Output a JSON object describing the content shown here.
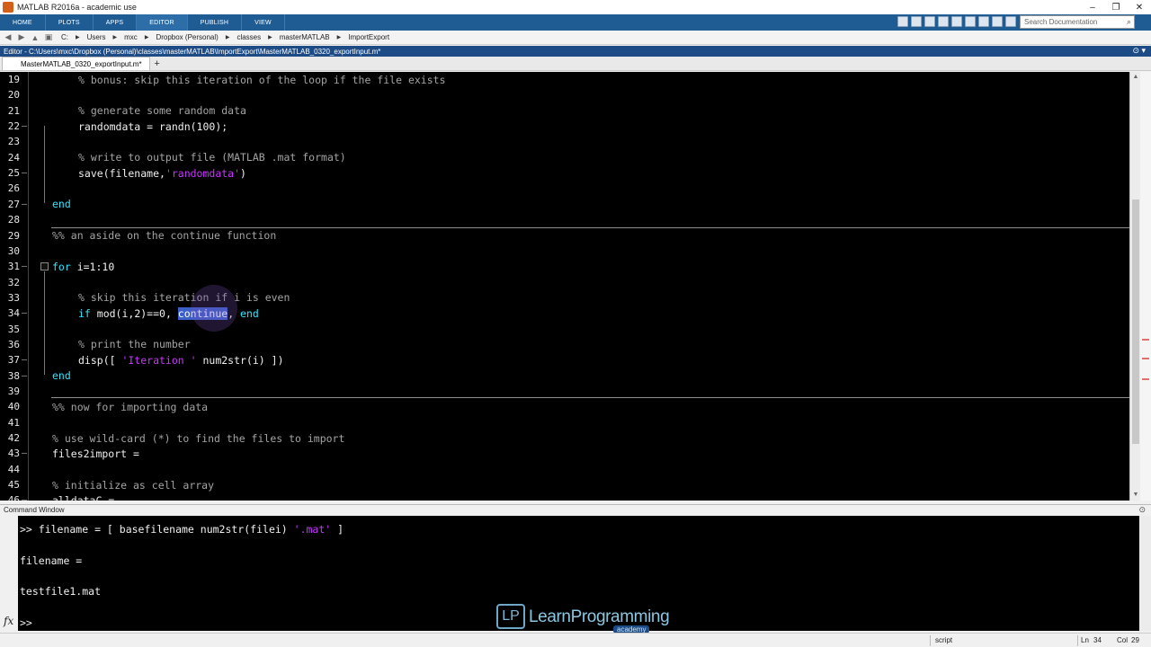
{
  "window": {
    "title": "MATLAB R2016a - academic use",
    "controls": [
      "–",
      "❐",
      "✕"
    ]
  },
  "ribbon": {
    "tabs": [
      {
        "label": "HOME",
        "active": false
      },
      {
        "label": "PLOTS",
        "active": false
      },
      {
        "label": "APPS",
        "active": false
      },
      {
        "label": "EDITOR",
        "active": true
      },
      {
        "label": "PUBLISH",
        "active": false
      },
      {
        "label": "VIEW",
        "active": false
      }
    ],
    "search_placeholder": "Search Documentation"
  },
  "pathbar": {
    "crumbs": [
      "C:",
      "Users",
      "mxc",
      "Dropbox (Personal)",
      "classes",
      "masterMATLAB",
      "ImportExport"
    ]
  },
  "editor": {
    "header": "Editor - C:\\Users\\mxc\\Dropbox (Personal)\\classes\\masterMATLAB\\ImportExport\\MasterMATLAB_0320_exportInput.m*",
    "file_tab": "MasterMATLAB_0320_exportInput.m*",
    "add_tab": "+",
    "lines": [
      {
        "n": "19",
        "dash": false,
        "indent": 1,
        "parts": [
          {
            "t": "% bonus: skip this iteration of the loop if the file exists",
            "c": "cm"
          }
        ]
      },
      {
        "n": "20",
        "dash": false,
        "indent": 0,
        "parts": []
      },
      {
        "n": "21",
        "dash": false,
        "indent": 1,
        "parts": [
          {
            "t": "% generate some random data",
            "c": "cm"
          }
        ]
      },
      {
        "n": "22",
        "dash": true,
        "indent": 1,
        "parts": [
          {
            "t": "randomdata = randn(100);",
            "c": ""
          }
        ]
      },
      {
        "n": "23",
        "dash": false,
        "indent": 0,
        "parts": []
      },
      {
        "n": "24",
        "dash": false,
        "indent": 1,
        "parts": [
          {
            "t": "% write to output file (MATLAB .mat format)",
            "c": "cm"
          }
        ]
      },
      {
        "n": "25",
        "dash": true,
        "indent": 1,
        "parts": [
          {
            "t": "save(filename,",
            "c": ""
          },
          {
            "t": "'randomdata'",
            "c": "str"
          },
          {
            "t": ")",
            "c": ""
          }
        ]
      },
      {
        "n": "26",
        "dash": false,
        "indent": 0,
        "parts": []
      },
      {
        "n": "27",
        "dash": true,
        "indent": 0,
        "parts": [
          {
            "t": "end",
            "c": "kw"
          }
        ]
      },
      {
        "n": "28",
        "dash": false,
        "indent": 0,
        "parts": []
      },
      {
        "n": "29",
        "dash": false,
        "indent": 0,
        "parts": [
          {
            "t": "%% an aside on the continue function",
            "c": "cm"
          }
        ]
      },
      {
        "n": "30",
        "dash": false,
        "indent": 0,
        "parts": []
      },
      {
        "n": "31",
        "dash": true,
        "indent": 0,
        "parts": [
          {
            "t": "for",
            "c": "kw"
          },
          {
            "t": " i=1:10",
            "c": ""
          }
        ]
      },
      {
        "n": "32",
        "dash": false,
        "indent": 0,
        "parts": []
      },
      {
        "n": "33",
        "dash": false,
        "indent": 1,
        "parts": [
          {
            "t": "% skip this iteration if i is even",
            "c": "cm"
          }
        ]
      },
      {
        "n": "34",
        "dash": true,
        "indent": 1,
        "parts": [
          {
            "t": "if",
            "c": "kw"
          },
          {
            "t": " mod(i,2)==0, ",
            "c": ""
          },
          {
            "t": "continue",
            "c": "sel"
          },
          {
            "t": ", ",
            "c": ""
          },
          {
            "t": "end",
            "c": "kw"
          }
        ]
      },
      {
        "n": "35",
        "dash": false,
        "indent": 0,
        "parts": []
      },
      {
        "n": "36",
        "dash": false,
        "indent": 1,
        "parts": [
          {
            "t": "% print the number",
            "c": "cm"
          }
        ]
      },
      {
        "n": "37",
        "dash": true,
        "indent": 1,
        "parts": [
          {
            "t": "disp([ ",
            "c": ""
          },
          {
            "t": "'Iteration '",
            "c": "str"
          },
          {
            "t": " num2str(i) ])",
            "c": ""
          }
        ]
      },
      {
        "n": "38",
        "dash": true,
        "indent": 0,
        "parts": [
          {
            "t": "end",
            "c": "kw"
          }
        ]
      },
      {
        "n": "39",
        "dash": false,
        "indent": 0,
        "parts": []
      },
      {
        "n": "40",
        "dash": false,
        "indent": 0,
        "parts": [
          {
            "t": "%% now for importing data",
            "c": "cm"
          }
        ]
      },
      {
        "n": "41",
        "dash": false,
        "indent": 0,
        "parts": []
      },
      {
        "n": "42",
        "dash": false,
        "indent": 0,
        "parts": [
          {
            "t": "% use wild-card (*) to find the files to import",
            "c": "cm"
          }
        ]
      },
      {
        "n": "43",
        "dash": true,
        "indent": 0,
        "parts": [
          {
            "t": "files2import =",
            "c": ""
          }
        ]
      },
      {
        "n": "44",
        "dash": false,
        "indent": 0,
        "parts": []
      },
      {
        "n": "45",
        "dash": false,
        "indent": 0,
        "parts": [
          {
            "t": "% initialize as cell array",
            "c": "cm"
          }
        ]
      },
      {
        "n": "46",
        "dash": true,
        "indent": 0,
        "parts": [
          {
            "t": "alldataC =",
            "c": ""
          }
        ]
      }
    ]
  },
  "command_window": {
    "title": "Command Window",
    "fx_label": "fx",
    "lines": [
      [
        {
          "t": ">> filename = [ basefilename num2str(filei) ",
          "c": ""
        },
        {
          "t": "'.mat'",
          "c": "str"
        },
        {
          "t": " ]",
          "c": ""
        }
      ],
      [],
      [
        {
          "t": "filename =",
          "c": ""
        }
      ],
      [],
      [
        {
          "t": "testfile1.mat",
          "c": ""
        }
      ],
      [],
      [
        {
          "t": ">>",
          "c": ""
        }
      ]
    ]
  },
  "logo": {
    "mark": "LP",
    "name": "LearnProgramming",
    "sub": "academy"
  },
  "status": {
    "mode": "script",
    "ln_label": "Ln",
    "ln": "34",
    "col_label": "Col",
    "col": "29"
  }
}
